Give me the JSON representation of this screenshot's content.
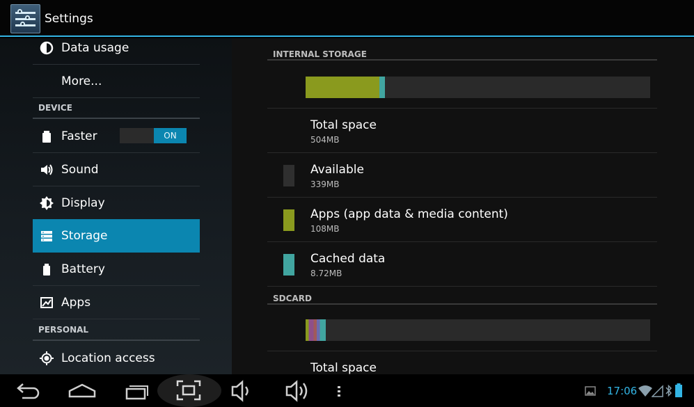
{
  "app": {
    "title": "Settings",
    "icon": "settings-sliders-icon"
  },
  "left_menu": {
    "items_top": [
      {
        "label": "Data usage",
        "icon": "data-usage-icon"
      },
      {
        "label": "More...",
        "icon": ""
      }
    ],
    "device_header": "DEVICE",
    "device_items": [
      {
        "label": "Faster",
        "icon": "battery-saver-icon",
        "toggle": "ON"
      },
      {
        "label": "Sound",
        "icon": "speaker-icon"
      },
      {
        "label": "Display",
        "icon": "brightness-icon"
      },
      {
        "label": "Storage",
        "icon": "storage-icon",
        "selected": true
      },
      {
        "label": "Battery",
        "icon": "battery-icon"
      },
      {
        "label": "Apps",
        "icon": "apps-icon"
      }
    ],
    "personal_header": "PERSONAL",
    "personal_items": [
      {
        "label": "Location access",
        "icon": "location-icon"
      }
    ]
  },
  "storage": {
    "internal": {
      "header": "INTERNAL STORAGE",
      "bar": {
        "apps_fraction": 0.214,
        "cached_fraction": 0.017
      },
      "rows": [
        {
          "name": "Total space",
          "value": "504MB",
          "swatch": ""
        },
        {
          "name": "Available",
          "value": "339MB",
          "swatch": "#2f2f2f"
        },
        {
          "name": "Apps (app data & media content)",
          "value": "108MB",
          "swatch": "#8a9a1e"
        },
        {
          "name": "Cached data",
          "value": "8.72MB",
          "swatch": "#41a5a0"
        }
      ]
    },
    "sdcard": {
      "header": "SDCARD",
      "bar": {
        "used_fraction": 0.058
      },
      "rows": [
        {
          "name": "Total space",
          "value": ""
        }
      ]
    }
  },
  "status_bar": {
    "time": "17:06",
    "icons": [
      "gallery-icon",
      "wifi-icon",
      "signal-icon",
      "bluetooth-icon",
      "battery-status-icon"
    ]
  },
  "nav_buttons": [
    "back-icon",
    "home-icon",
    "recent-apps-icon",
    "screenshot-icon",
    "volume-down-icon",
    "volume-up-icon",
    "overflow-menu-icon"
  ],
  "colors": {
    "accent": "#33b5e5",
    "selected": "#0b86b0",
    "apps": "#8a9a1e",
    "cached": "#41a5a0"
  }
}
